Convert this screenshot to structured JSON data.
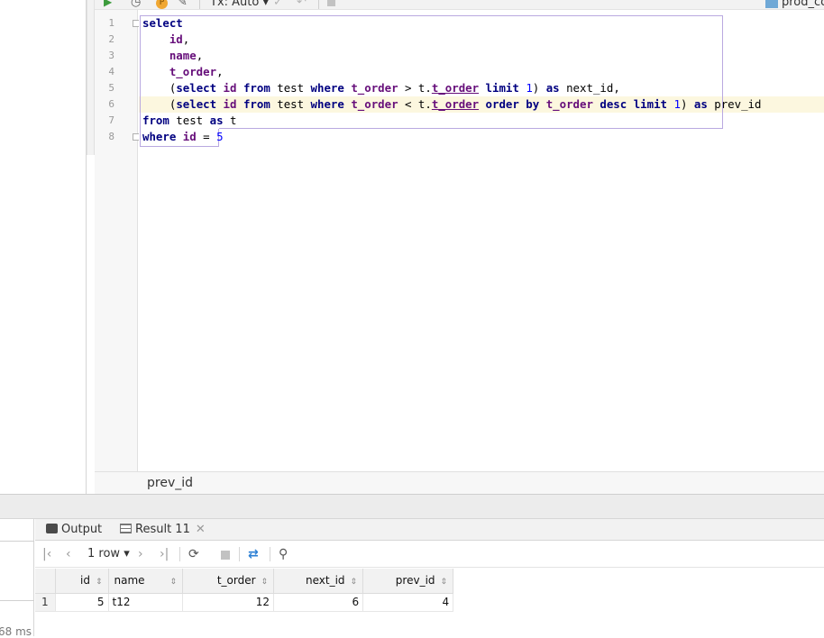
{
  "toolbar": {
    "tx_mode": "Tx: Auto",
    "db_name": "prod_co"
  },
  "editor": {
    "line_numbers": [
      "1",
      "2",
      "3",
      "4",
      "5",
      "6",
      "7",
      "8"
    ],
    "breadcrumb": "prev_id"
  },
  "results": {
    "tabs": [
      {
        "label": "Output"
      },
      {
        "label": "Result 11"
      }
    ],
    "row_count": "1 row",
    "columns": [
      "id",
      "name",
      "t_order",
      "next_id",
      "prev_id"
    ],
    "rows": [
      {
        "row_no": "1",
        "id": "5",
        "name": "t12",
        "t_order": "12",
        "next_id": "6",
        "prev_id": "4"
      }
    ]
  },
  "status": {
    "timing": "68 ms"
  },
  "colors": {
    "keyword": "#000080",
    "column": "#660e7a",
    "number": "#0000ff",
    "current_line": "#fcf7df",
    "statement_border": "#b9a9e0"
  }
}
